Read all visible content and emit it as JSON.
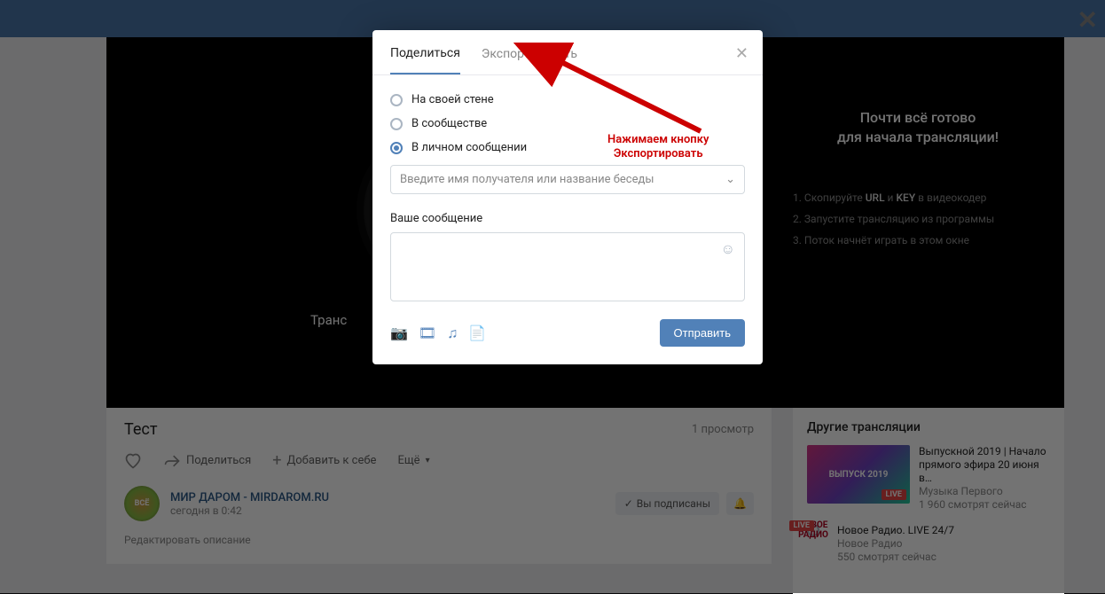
{
  "modal": {
    "tab_share": "Поделиться",
    "tab_export": "Экспортировать",
    "radio_wall": "На своей стене",
    "radio_community": "В сообществе",
    "radio_pm": "В личном сообщении",
    "recipient_placeholder": "Введите имя получателя или название беседы",
    "message_label": "Ваше сообщение",
    "send": "Отправить"
  },
  "annotation": {
    "line1": "Нажимаем кнопку",
    "line2": "Экспортировать"
  },
  "right_panel": {
    "title_l1": "Почти всё готово",
    "title_l2": "для начала трансляции!",
    "step1_a": "Скопируйте ",
    "step1_b": "URL",
    "step1_c": " и ",
    "step1_d": "KEY",
    "step1_e": " в видеокодер",
    "step2": "Запустите трансляцию из программы",
    "step3": "Поток начнёт играть в этом окне"
  },
  "video": {
    "trans_label": "Транс"
  },
  "under": {
    "title": "Тест",
    "views": "1 просмотр",
    "share": "Поделиться",
    "add": "Добавить к себе",
    "more": "Ещё",
    "author_name": "МИР ДАРОМ - MIRDAROM.RU",
    "author_time": "сегодня в 0:42",
    "subscribed": "Вы подписаны",
    "edit": "Редактировать описание",
    "avatar_text": "ВСЁ"
  },
  "other": {
    "header": "Другие трансляции",
    "s1_thumb": "ВЫПУСК 2019",
    "s1_title": "Выпускной 2019 | Начало прямого эфира 20 июня в…",
    "s1_sub1": "Музыка Первого",
    "s1_sub2": "1 960 смотрят сейчас",
    "s2_thumb": "НОВОЕ РАДИО",
    "s2_title": "Новое Радио. LIVE 24/7",
    "s2_sub1": "Новое Радио",
    "s2_sub2": "550 смотрят сейчас",
    "live": "LIVE"
  }
}
